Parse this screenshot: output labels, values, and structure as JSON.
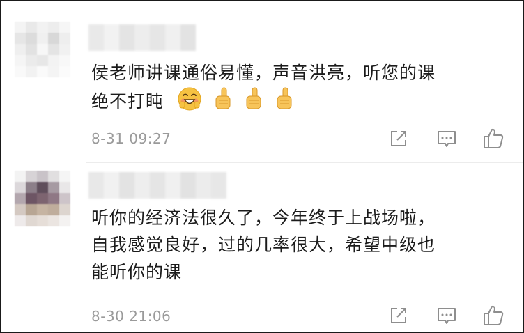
{
  "comments": [
    {
      "text_lines": [
        "侯老师讲课通俗易懂，声音洪亮，听您的课",
        "绝不打盹"
      ],
      "emojis": [
        "grinning-blush-face-icon",
        "thumbs-up-icon",
        "thumbs-up-icon",
        "thumbs-up-icon"
      ],
      "timestamp": "8-31 09:27"
    },
    {
      "text_lines": [
        "听你的经济法很久了，今年终于上战场啦，",
        "自我感觉良好，过的几率很大，希望中级也",
        "能听你的课"
      ],
      "timestamp": "8-30 21:06"
    }
  ],
  "actions": [
    "share-icon",
    "comment-icon",
    "like-icon"
  ],
  "colors": {
    "text": "#1b1b1b",
    "meta": "#9a9a9a",
    "divider": "#ececec",
    "emoji_yellow": "#f6c242"
  }
}
